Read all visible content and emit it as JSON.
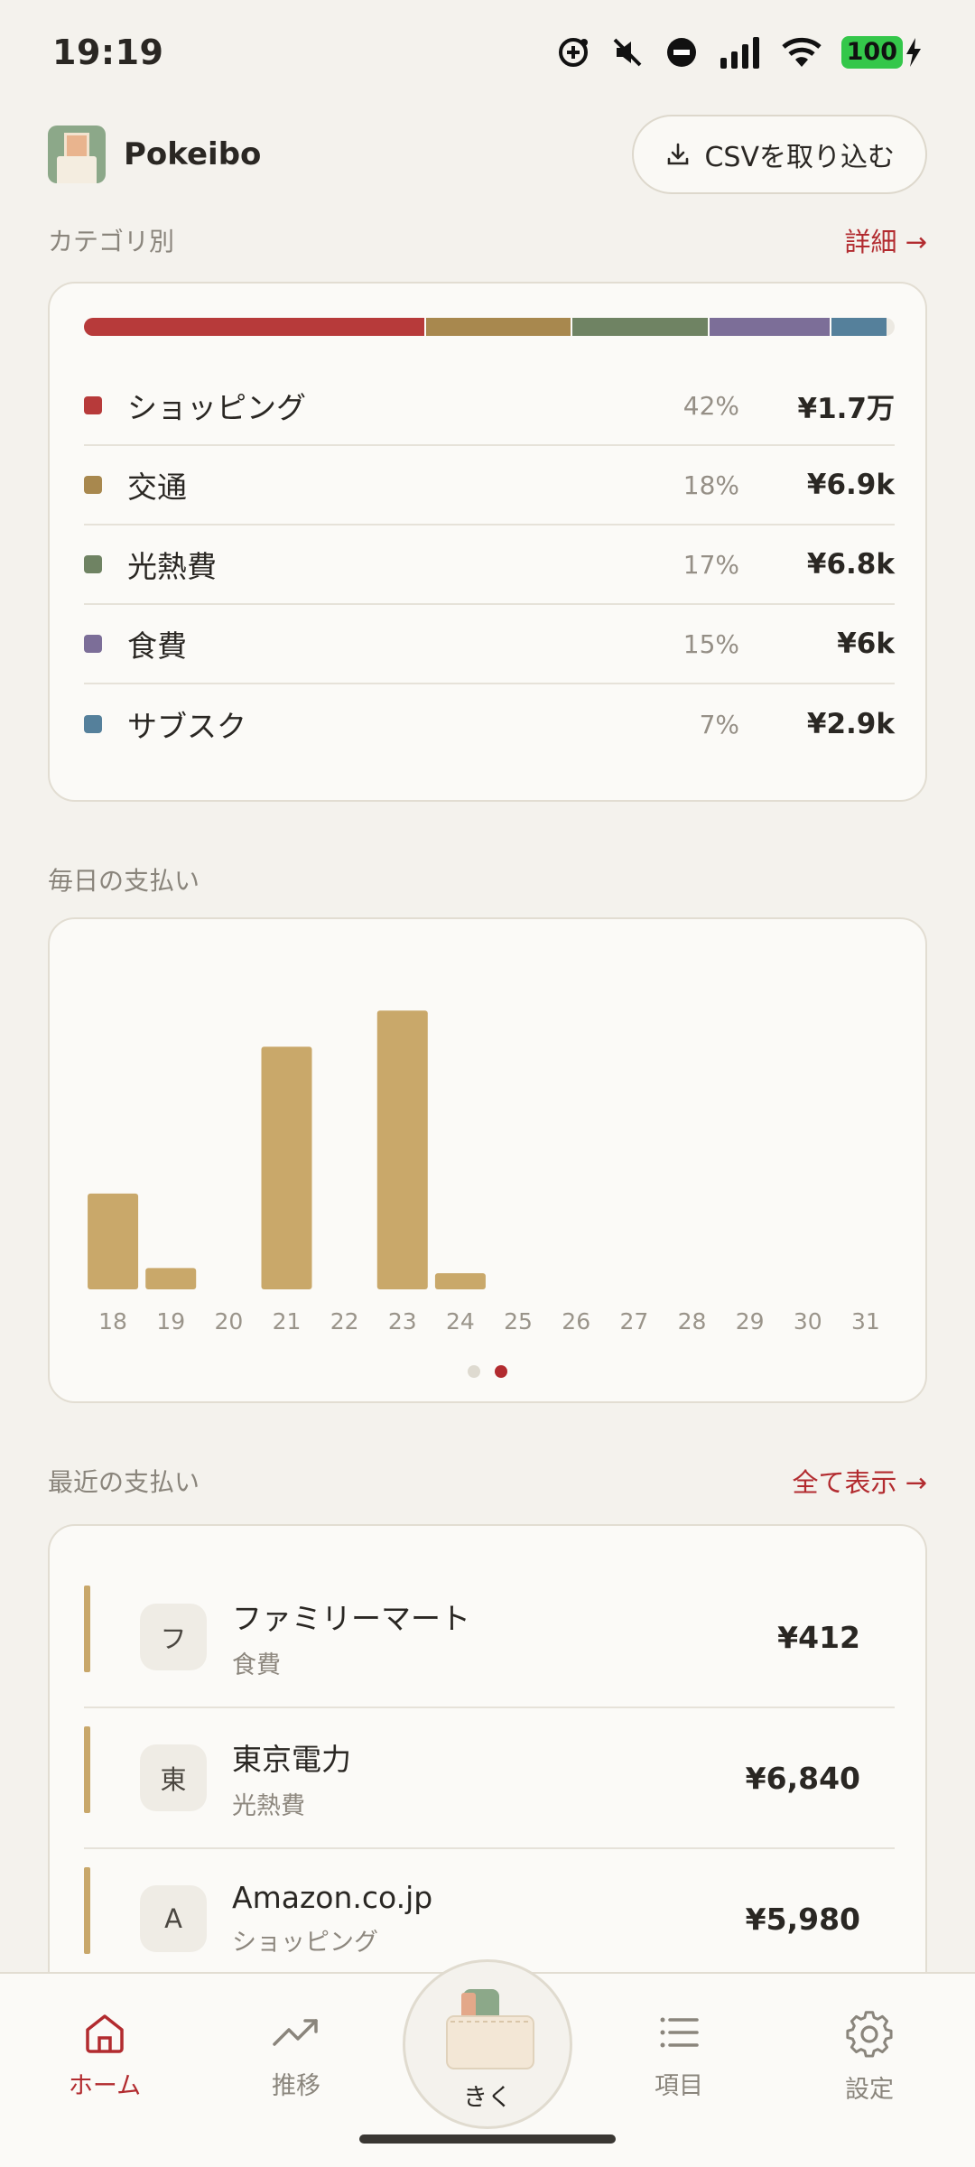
{
  "status_bar": {
    "time": "19:19",
    "battery": "100",
    "icons": [
      "add-circle-icon",
      "mute-icon",
      "do-not-disturb-icon",
      "signal-icon",
      "wifi-icon",
      "battery-charging-icon"
    ]
  },
  "header": {
    "app_name": "Pokeibo",
    "import_button": "CSVを取り込む"
  },
  "category_section": {
    "title": "カテゴリ別",
    "link": "詳細 →",
    "items": [
      {
        "name": "ショッピング",
        "percent": "42%",
        "amount": "¥1.7万",
        "share": 42,
        "color": "#b73a3a"
      },
      {
        "name": "交通",
        "percent": "18%",
        "amount": "¥6.9k",
        "share": 18,
        "color": "#a8884e"
      },
      {
        "name": "光熱費",
        "percent": "17%",
        "amount": "¥6.8k",
        "share": 17,
        "color": "#6f8363"
      },
      {
        "name": "食費",
        "percent": "15%",
        "amount": "¥6k",
        "share": 15,
        "color": "#7c6e98"
      },
      {
        "name": "サブスク",
        "percent": "7%",
        "amount": "¥2.9k",
        "share": 7,
        "color": "#55809b"
      }
    ]
  },
  "daily_section": {
    "title": "毎日の支払い",
    "pager": {
      "pages": 2,
      "active": 2
    }
  },
  "chart_data": {
    "type": "bar",
    "categories": [
      "18",
      "19",
      "20",
      "21",
      "22",
      "23",
      "24",
      "25",
      "26",
      "27",
      "28",
      "29",
      "30",
      "31"
    ],
    "values": [
      2250,
      500,
      0,
      5700,
      0,
      6550,
      380,
      0,
      0,
      0,
      0,
      0,
      0,
      0
    ],
    "ylim": [
      0,
      7000
    ],
    "bar_color": "#c9a86a",
    "grid": false,
    "title": "",
    "xlabel": "",
    "ylabel": ""
  },
  "recent_section": {
    "title": "最近の支払い",
    "link": "全て表示 →",
    "items": [
      {
        "initial": "フ",
        "name": "ファミリーマート",
        "category": "食費",
        "amount": "¥412"
      },
      {
        "initial": "東",
        "name": "東京電力",
        "category": "光熱費",
        "amount": "¥6,840"
      },
      {
        "initial": "A",
        "name": "Amazon.co.jp",
        "category": "ショッピング",
        "amount": "¥5,980"
      }
    ]
  },
  "bottom_nav": {
    "home": "ホーム",
    "trends": "推移",
    "center": "きく",
    "items": "項目",
    "settings": "設定"
  },
  "colors": {
    "accent": "#b22b2f",
    "background": "#f4f2ed",
    "card": "#fbfaf7"
  }
}
